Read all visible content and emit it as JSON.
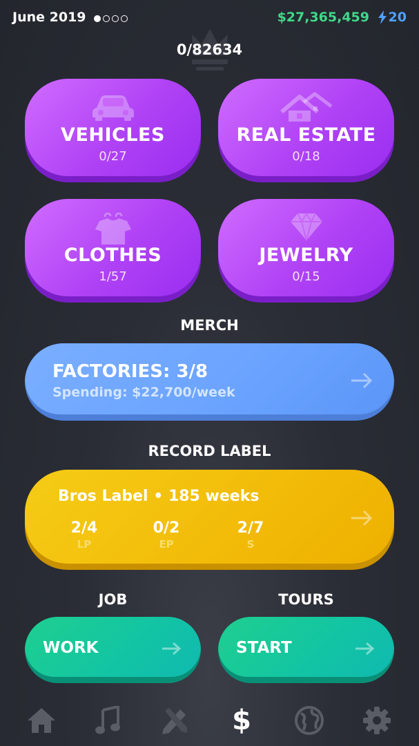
{
  "header": {
    "date": "June 2019",
    "money": "$27,365,459",
    "energy": "20",
    "dots": [
      true,
      false,
      false,
      false
    ]
  },
  "fans": {
    "value": "0/82634"
  },
  "categories": [
    {
      "title": "VEHICLES",
      "count": "0/27",
      "icon": "car-icon"
    },
    {
      "title": "REAL ESTATE",
      "count": "0/18",
      "icon": "house-icon"
    },
    {
      "title": "CLOTHES",
      "count": "1/57",
      "icon": "shirt-icon"
    },
    {
      "title": "JEWELRY",
      "count": "0/15",
      "icon": "diamond-icon"
    }
  ],
  "merch": {
    "section": "MERCH",
    "title": "FACTORIES: 3/8",
    "subtitle": "Spending: $22,700/week"
  },
  "record_label": {
    "section": "RECORD LABEL",
    "title": "Bros Label • 185 weeks",
    "stats": [
      {
        "value": "2/4",
        "label": "LP"
      },
      {
        "value": "0/2",
        "label": "EP"
      },
      {
        "value": "2/7",
        "label": "S"
      }
    ]
  },
  "job": {
    "section": "JOB",
    "button": "WORK"
  },
  "tours": {
    "section": "TOURS",
    "button": "START"
  },
  "nav": {
    "items": [
      "home-icon",
      "music-icon",
      "pencil-brush-icon",
      "dollar-icon",
      "globe-icon",
      "gear-icon"
    ],
    "active": "dollar-icon",
    "dollar_symbol": "$"
  },
  "colors": {
    "money": "#3fd98a",
    "energy": "#4ea2ff",
    "purple": "#b042f5",
    "blue": "#6aa3ff",
    "yellow": "#f2bb08",
    "green": "#12c4a4"
  }
}
